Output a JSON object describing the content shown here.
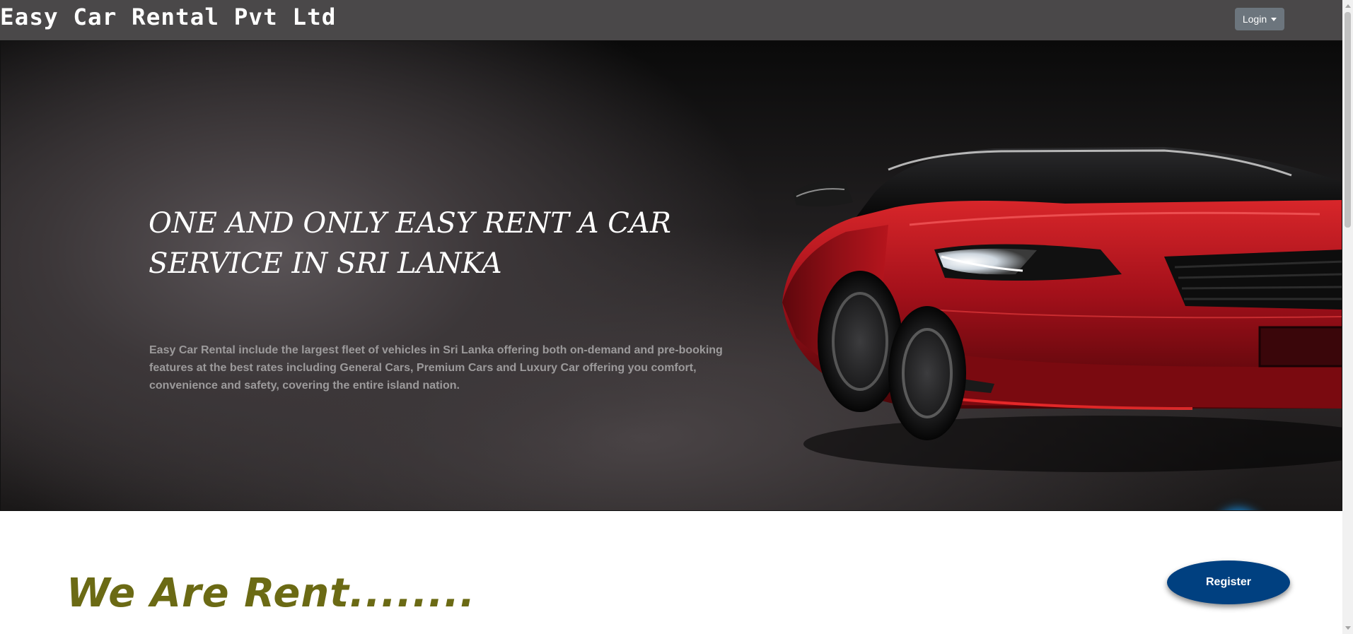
{
  "navbar": {
    "brand": "Easy Car Rental Pvt Ltd",
    "login_label": "Login"
  },
  "hero": {
    "title": "ONE AND ONLY EASY RENT A CAR SERVICE IN SRI LANKA",
    "description": "Easy Car Rental include the largest fleet of vehicles in Sri Lanka offering both on-demand and pre-booking features at the best rates including General Cars, Premium Cars and Luxury Car offering you comfort, convenience and safety, covering the entire island nation."
  },
  "section": {
    "title": "We Are Rent........"
  },
  "actions": {
    "register_label": "Register"
  },
  "icons": {
    "call": "phone-call-icon",
    "car": "car-image"
  },
  "colors": {
    "navbar_bg": "#4a4849",
    "login_bg": "#6c757d",
    "register_bg": "#004080",
    "section_title": "#6b6a14",
    "call_button": "#0b7fc6"
  }
}
